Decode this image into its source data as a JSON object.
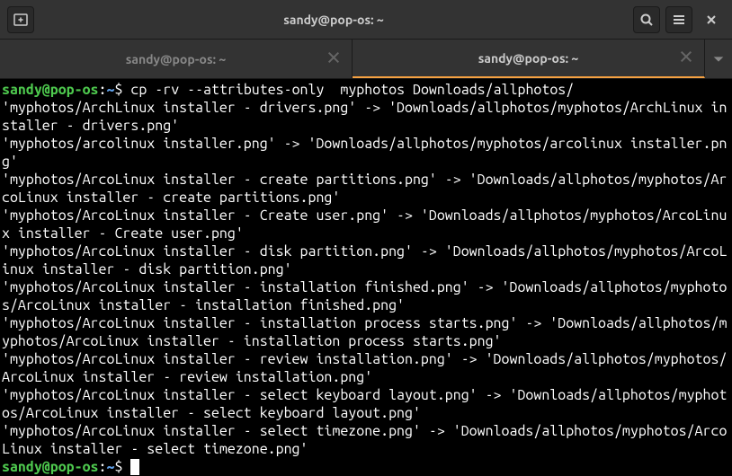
{
  "window": {
    "title": "sandy@pop-os: ~"
  },
  "tabs": [
    {
      "label": "sandy@pop-os: ~",
      "active": false
    },
    {
      "label": "sandy@pop-os: ~",
      "active": true
    }
  ],
  "prompt": {
    "user_host": "sandy@pop-os",
    "colon": ":",
    "path": "~",
    "dollar": "$"
  },
  "command": " cp -rv --attributes-only  myphotos Downloads/allphotos/",
  "output": "'myphotos/ArchLinux installer - drivers.png' -> 'Downloads/allphotos/myphotos/ArchLinux installer - drivers.png'\n'myphotos/arcolinux installer.png' -> 'Downloads/allphotos/myphotos/arcolinux installer.png'\n'myphotos/ArcoLinux installer - create partitions.png' -> 'Downloads/allphotos/myphotos/ArcoLinux installer - create partitions.png'\n'myphotos/ArcoLinux installer - Create user.png' -> 'Downloads/allphotos/myphotos/ArcoLinux installer - Create user.png'\n'myphotos/ArcoLinux installer - disk partition.png' -> 'Downloads/allphotos/myphotos/ArcoLinux installer - disk partition.png'\n'myphotos/ArcoLinux installer - installation finished.png' -> 'Downloads/allphotos/myphotos/ArcoLinux installer - installation finished.png'\n'myphotos/ArcoLinux installer - installation process starts.png' -> 'Downloads/allphotos/myphotos/ArcoLinux installer - installation process starts.png'\n'myphotos/ArcoLinux installer - review installation.png' -> 'Downloads/allphotos/myphotos/ArcoLinux installer - review installation.png'\n'myphotos/ArcoLinux installer - select keyboard layout.png' -> 'Downloads/allphotos/myphotos/ArcoLinux installer - select keyboard layout.png'\n'myphotos/ArcoLinux installer - select timezone.png' -> 'Downloads/allphotos/myphotos/ArcoLinux installer - select timezone.png'"
}
